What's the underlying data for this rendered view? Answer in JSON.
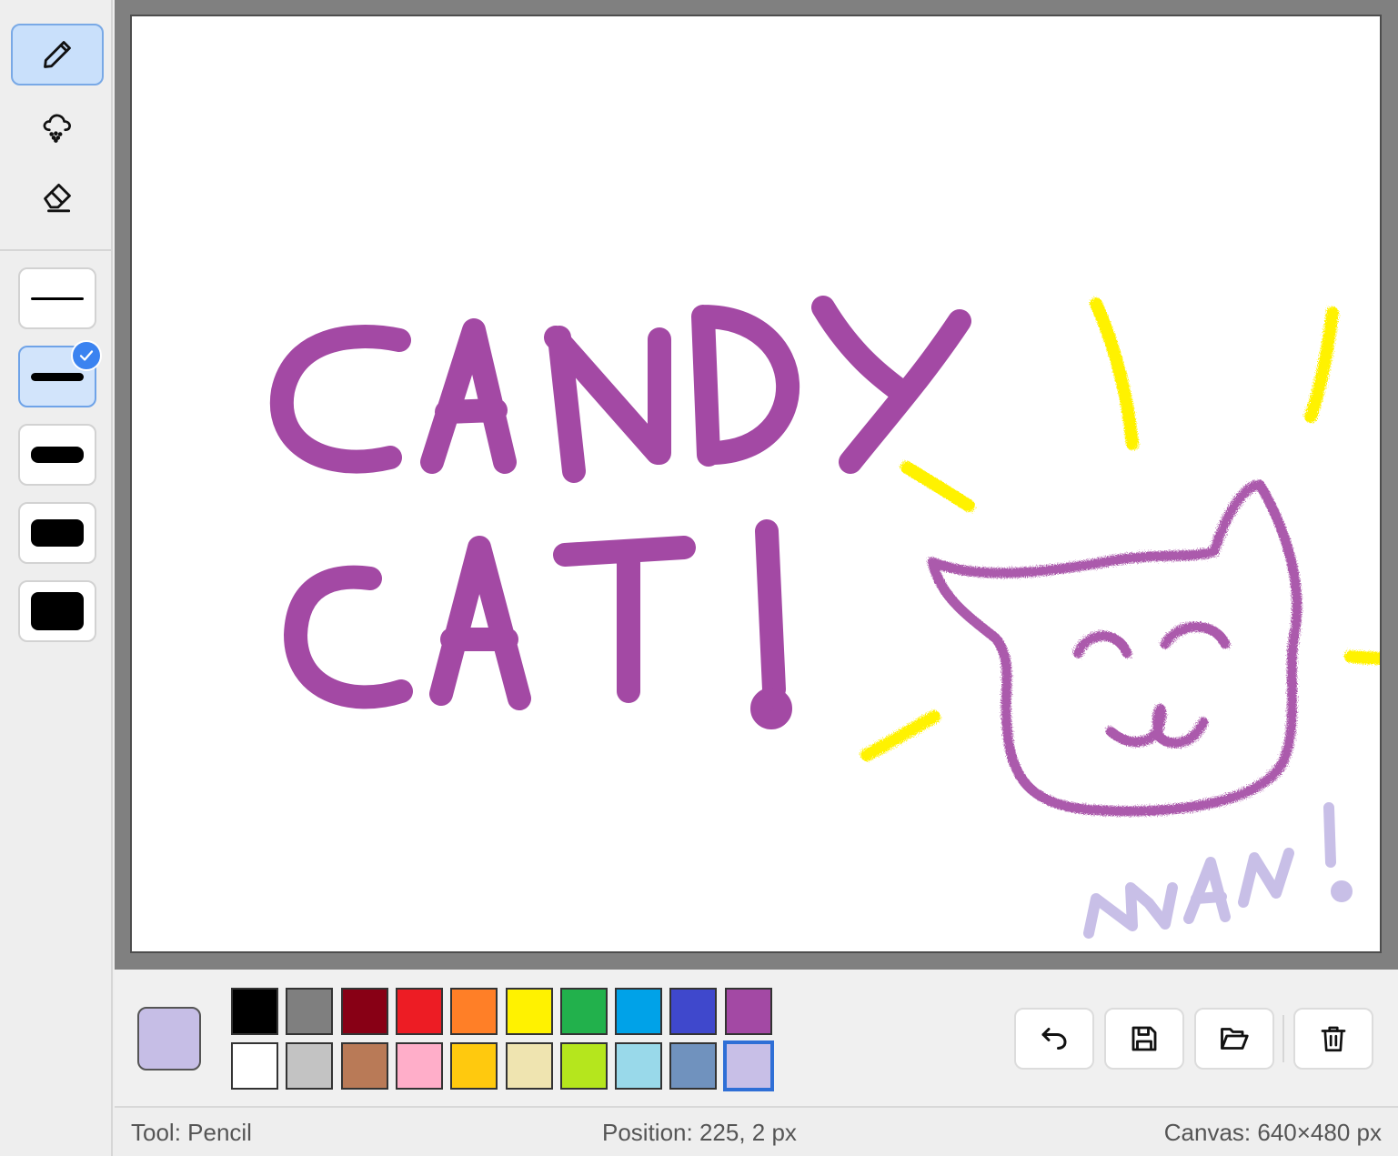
{
  "tools": [
    {
      "name": "pencil",
      "icon": "pencil-icon",
      "active": true
    },
    {
      "name": "spray",
      "icon": "spray-cloud-icon",
      "active": false
    },
    {
      "name": "eraser",
      "icon": "eraser-icon",
      "active": false
    }
  ],
  "brush_sizes": {
    "count": 5,
    "selected_index": 1
  },
  "current_color": "#c6bee6",
  "palette": {
    "row1": [
      "#000000",
      "#7f7f7f",
      "#880015",
      "#ed1c24",
      "#ff7f27",
      "#fff200",
      "#22b14c",
      "#00a2e8",
      "#3f48cc",
      "#a349a4"
    ],
    "row2": [
      "#ffffff",
      "#c3c3c3",
      "#b97a57",
      "#ffaec9",
      "#ffc90e",
      "#efe4b0",
      "#b5e61d",
      "#99d9ea",
      "#7092be",
      "#c8bfe7"
    ],
    "selected": "#c8bfe7"
  },
  "actions": [
    {
      "name": "undo",
      "icon": "undo-icon"
    },
    {
      "name": "save",
      "icon": "save-icon"
    },
    {
      "name": "open",
      "icon": "folder-open-icon"
    },
    {
      "name": "clear",
      "icon": "trash-icon"
    }
  ],
  "status": {
    "tool": "Tool: Pencil",
    "position": "Position: 225, 2 px",
    "canvas": "Canvas: 640×480 px"
  },
  "colors": {
    "drawing_purple": "#a349a4",
    "drawing_yellow": "#fff200",
    "drawing_lavender": "#c8bfe7",
    "accent": "#3b83f0"
  }
}
